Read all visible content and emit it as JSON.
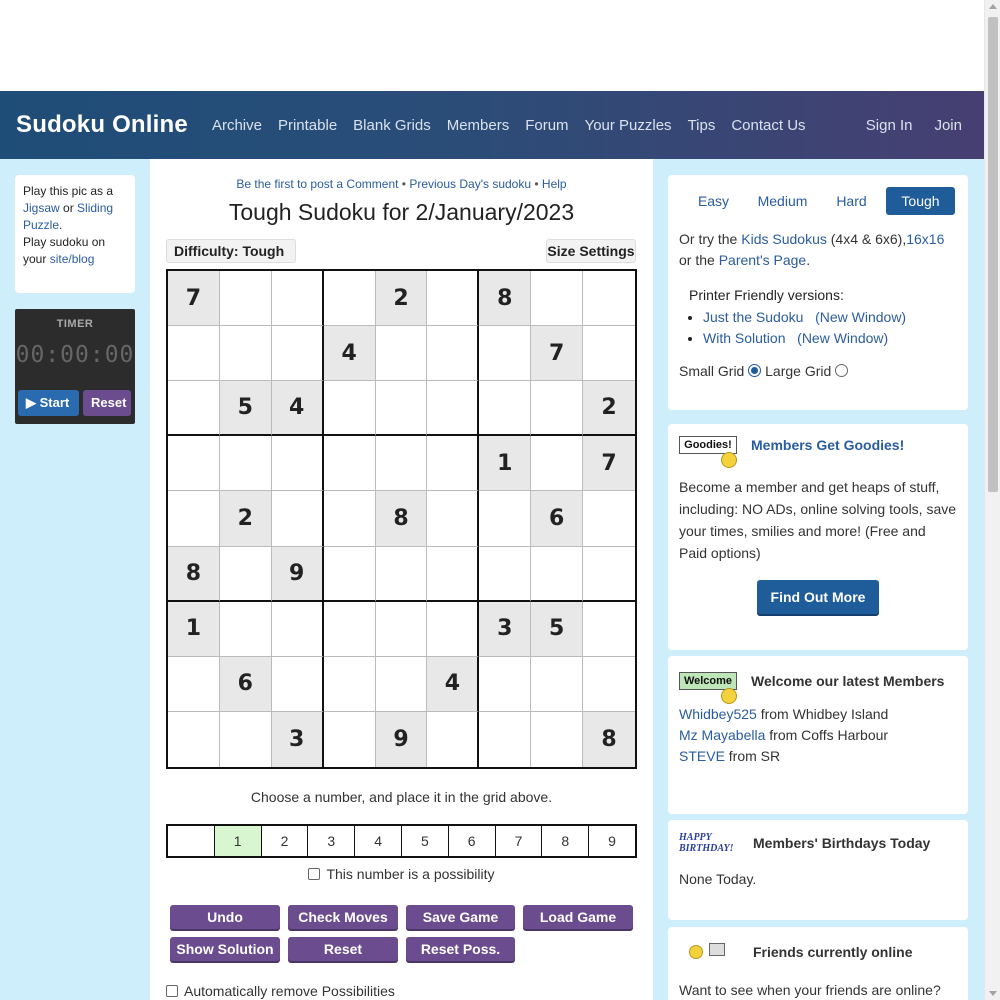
{
  "nav": {
    "brand": "Sudoku Online",
    "links": [
      "Archive",
      "Printable",
      "Blank Grids",
      "Members",
      "Forum",
      "Your Puzzles",
      "Tips",
      "Contact Us"
    ],
    "right": [
      "Sign In",
      "Join"
    ]
  },
  "left": {
    "play_text_1": "Play this pic as a",
    "jigsaw": "Jigsaw",
    "or": "or",
    "sliding": "Sliding Puzzle",
    "period": ".",
    "play_text_2": "Play sudoku on your",
    "site_blog": "site/blog",
    "timer": {
      "label": "TIMER",
      "display": "00:00:00",
      "start": "Start",
      "reset": "Reset"
    }
  },
  "main": {
    "top_links": {
      "comment": "Be the first to post a Comment",
      "previous": "Previous Day's sudoku",
      "help": "Help",
      "sep": "•"
    },
    "title": "Tough Sudoku for 2/January/2023",
    "difficulty_button": "Difficulty: Tough",
    "size_button": "Size Settings",
    "grid": [
      [
        "7",
        "",
        "",
        "",
        "2",
        "",
        "8",
        "",
        ""
      ],
      [
        "",
        "",
        "",
        "4",
        "",
        "",
        "",
        "7",
        ""
      ],
      [
        "",
        "5",
        "4",
        "",
        "",
        "",
        "",
        "",
        "2"
      ],
      [
        "",
        "",
        "",
        "",
        "",
        "",
        "1",
        "",
        "7"
      ],
      [
        "",
        "2",
        "",
        "",
        "8",
        "",
        "",
        "6",
        ""
      ],
      [
        "8",
        "",
        "9",
        "",
        "",
        "",
        "",
        "",
        ""
      ],
      [
        "1",
        "",
        "",
        "",
        "",
        "",
        "3",
        "5",
        ""
      ],
      [
        "",
        "6",
        "",
        "",
        "",
        "4",
        "",
        "",
        ""
      ],
      [
        "",
        "",
        "3",
        "",
        "9",
        "",
        "",
        "",
        "8"
      ]
    ],
    "choose_text": "Choose a number, and place it in the grid above.",
    "number_choices": [
      "",
      "1",
      "2",
      "3",
      "4",
      "5",
      "6",
      "7",
      "8",
      "9"
    ],
    "selected_number": "1",
    "possibility_label": "This number is a possibility",
    "buttons": {
      "undo": "Undo",
      "check_moves": "Check Moves",
      "save_game": "Save Game",
      "load_game": "Load Game",
      "show_solution": "Show Solution",
      "reset": "Reset",
      "reset_poss": "Reset Poss."
    },
    "auto_remove_label": "Automatically remove Possibilities"
  },
  "right": {
    "tabs": [
      "Easy",
      "Medium",
      "Hard",
      "Tough"
    ],
    "active_tab": "Tough",
    "or_try": "Or try the",
    "kids_link": "Kids Sudokus",
    "kids_sizes": "(4x4 & 6x6),",
    "sixteen_link": "16x16",
    "or_the": "or the",
    "parent_link": "Parent's Page",
    "printer_heading": "Printer Friendly versions:",
    "printer_items": [
      {
        "label": "Just the Sudoku",
        "new_window": "(New Window)"
      },
      {
        "label": "With Solution",
        "new_window": "(New Window)"
      }
    ],
    "small_grid": "Small Grid",
    "large_grid": "Large Grid",
    "goodies": {
      "sign": "Goodies!",
      "title": "Members Get Goodies!",
      "text": "Become a member and get heaps of stuff, including: NO ADs, online solving tools, save your times, smilies and more! (Free and Paid options)",
      "button": "Find Out More"
    },
    "welcome": {
      "sign": "Welcome",
      "title": "Welcome our latest Members",
      "members": [
        {
          "name": "Whidbey525",
          "from": "from Whidbey Island"
        },
        {
          "name": "Mz Mayabella",
          "from": "from Coffs Harbour"
        },
        {
          "name": "STEVE",
          "from": "from SR"
        }
      ]
    },
    "birthdays": {
      "sign_1": "HAPPY",
      "sign_2": "BIRTHDAY!",
      "title": "Members' Birthdays Today",
      "text": "None Today."
    },
    "friends": {
      "title": "Friends currently online",
      "text": "Want to see when your friends are online?"
    }
  },
  "colors": {
    "nav_start": "#1e4d78",
    "nav_end": "#473f72",
    "sidebar_bg": "#cfeefc",
    "purple_button": "#6b4d8f",
    "blue_button": "#1f5c9a",
    "selected_number_bg": "#d8f7d0"
  }
}
